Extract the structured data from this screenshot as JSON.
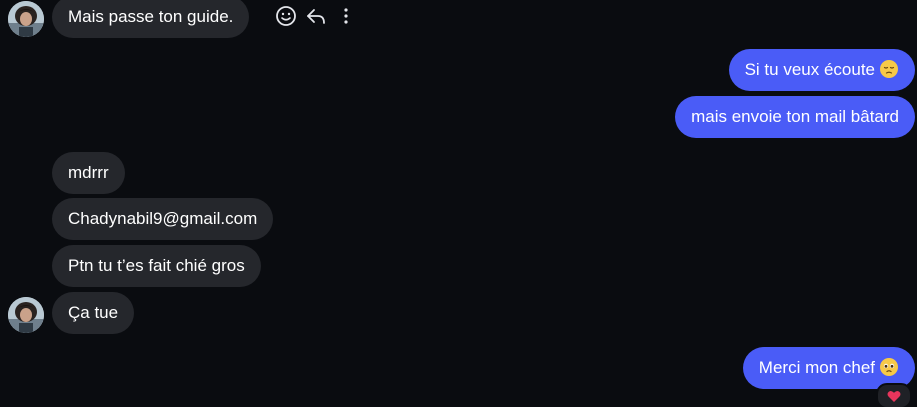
{
  "messages": [
    {
      "text": "Mais passe ton guide.",
      "direction": "incoming"
    },
    {
      "text": "Si tu veux écoute",
      "direction": "outgoing",
      "emoji": "pensive-face-icon"
    },
    {
      "text": "mais envoie ton mail bâtard",
      "direction": "outgoing"
    },
    {
      "text": "mdrrr",
      "direction": "incoming"
    },
    {
      "text": "Chadynabil9@gmail.com",
      "direction": "incoming"
    },
    {
      "text": "Ptn tu t’es fait chié gros",
      "direction": "incoming"
    },
    {
      "text": "Ça tue",
      "direction": "incoming"
    },
    {
      "text": "Merci mon chef",
      "direction": "outgoing",
      "emoji": "pleading-face-icon",
      "reaction": "heart-icon"
    }
  ],
  "hover_actions": [
    "smiley-icon",
    "reply-icon",
    "more-options-icon"
  ],
  "colors": {
    "background": "#0a0c10",
    "incoming_bubble": "#25272c",
    "outgoing_bubble": "#4a5cf7",
    "text": "#ffffff",
    "reaction_heart": "#e8355c"
  }
}
